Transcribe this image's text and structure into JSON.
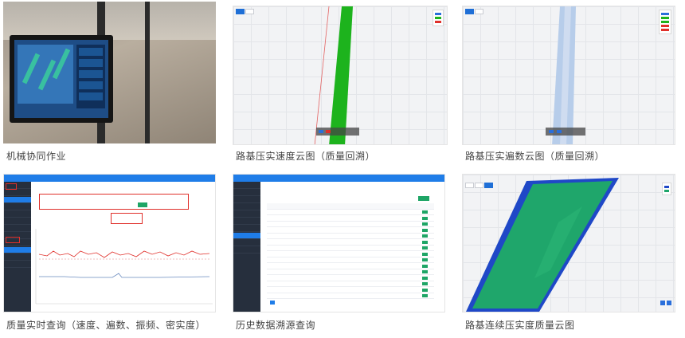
{
  "tiles": [
    {
      "caption": "机械协同作业"
    },
    {
      "caption": "路基压实速度云图（质量回溯）"
    },
    {
      "caption": "路基压实遍数云图（质量回溯）"
    },
    {
      "caption": "质量实时查询（速度、遍数、振频、密实度）"
    },
    {
      "caption": "历史数据溯源查询"
    },
    {
      "caption": "路基连续压实度质量云图"
    }
  ],
  "colors": {
    "brand_blue": "#1f7de8",
    "track_green": "#1db31d",
    "pass_blue": "#b7cdea",
    "sidebar_dark": "#262f3d",
    "alert_red": "#e0302b",
    "action_green": "#1ea566"
  },
  "icons": [
    "zoom-in-icon",
    "zoom-out-icon"
  ]
}
